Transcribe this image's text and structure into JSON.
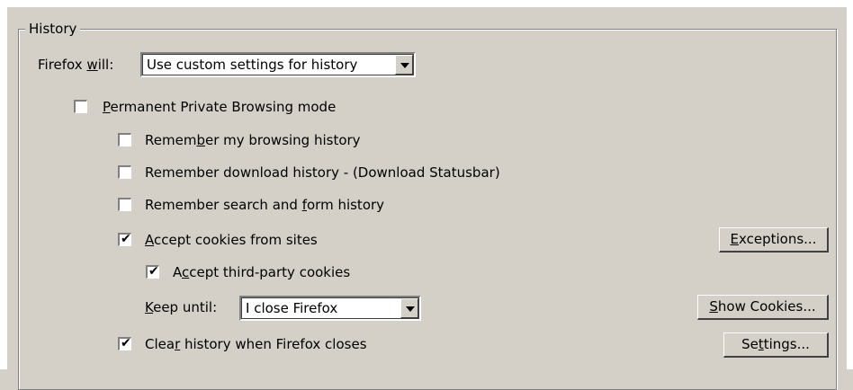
{
  "history": {
    "group_label": "History",
    "firefox_will_label_prefix": "Firefox ",
    "firefox_will_label_u": "w",
    "firefox_will_label_suffix": "ill:",
    "firefox_will_value": "Use custom settings for history",
    "ppb": {
      "u": "P",
      "rest": "ermanent Private Browsing mode",
      "checked": false
    },
    "browsing": {
      "pre": "Remem",
      "u": "b",
      "rest": "er my browsing history",
      "checked": false
    },
    "download": {
      "text": "Remember download history - (Download Statusbar)",
      "checked": false
    },
    "search": {
      "pre": "Remember search and ",
      "u": "f",
      "rest": "orm history",
      "checked": false
    },
    "cookies": {
      "u": "A",
      "rest": "ccept cookies from sites",
      "checked": true
    },
    "third_party": {
      "pre": "A",
      "u": "c",
      "rest": "cept third-party cookies",
      "checked": true
    },
    "keep_until_u": "K",
    "keep_until_rest": "eep until:",
    "keep_until_value": "I close Firefox",
    "clear": {
      "pre": "Clea",
      "u": "r",
      "rest": " history when Firefox closes",
      "checked": true
    },
    "exceptions": {
      "u": "E",
      "rest": "xceptions..."
    },
    "show_cookies": {
      "u": "S",
      "rest": "how Cookies..."
    },
    "settings": {
      "pre": "Se",
      "u": "t",
      "rest": "tings..."
    },
    "check_glyph": "✔"
  }
}
